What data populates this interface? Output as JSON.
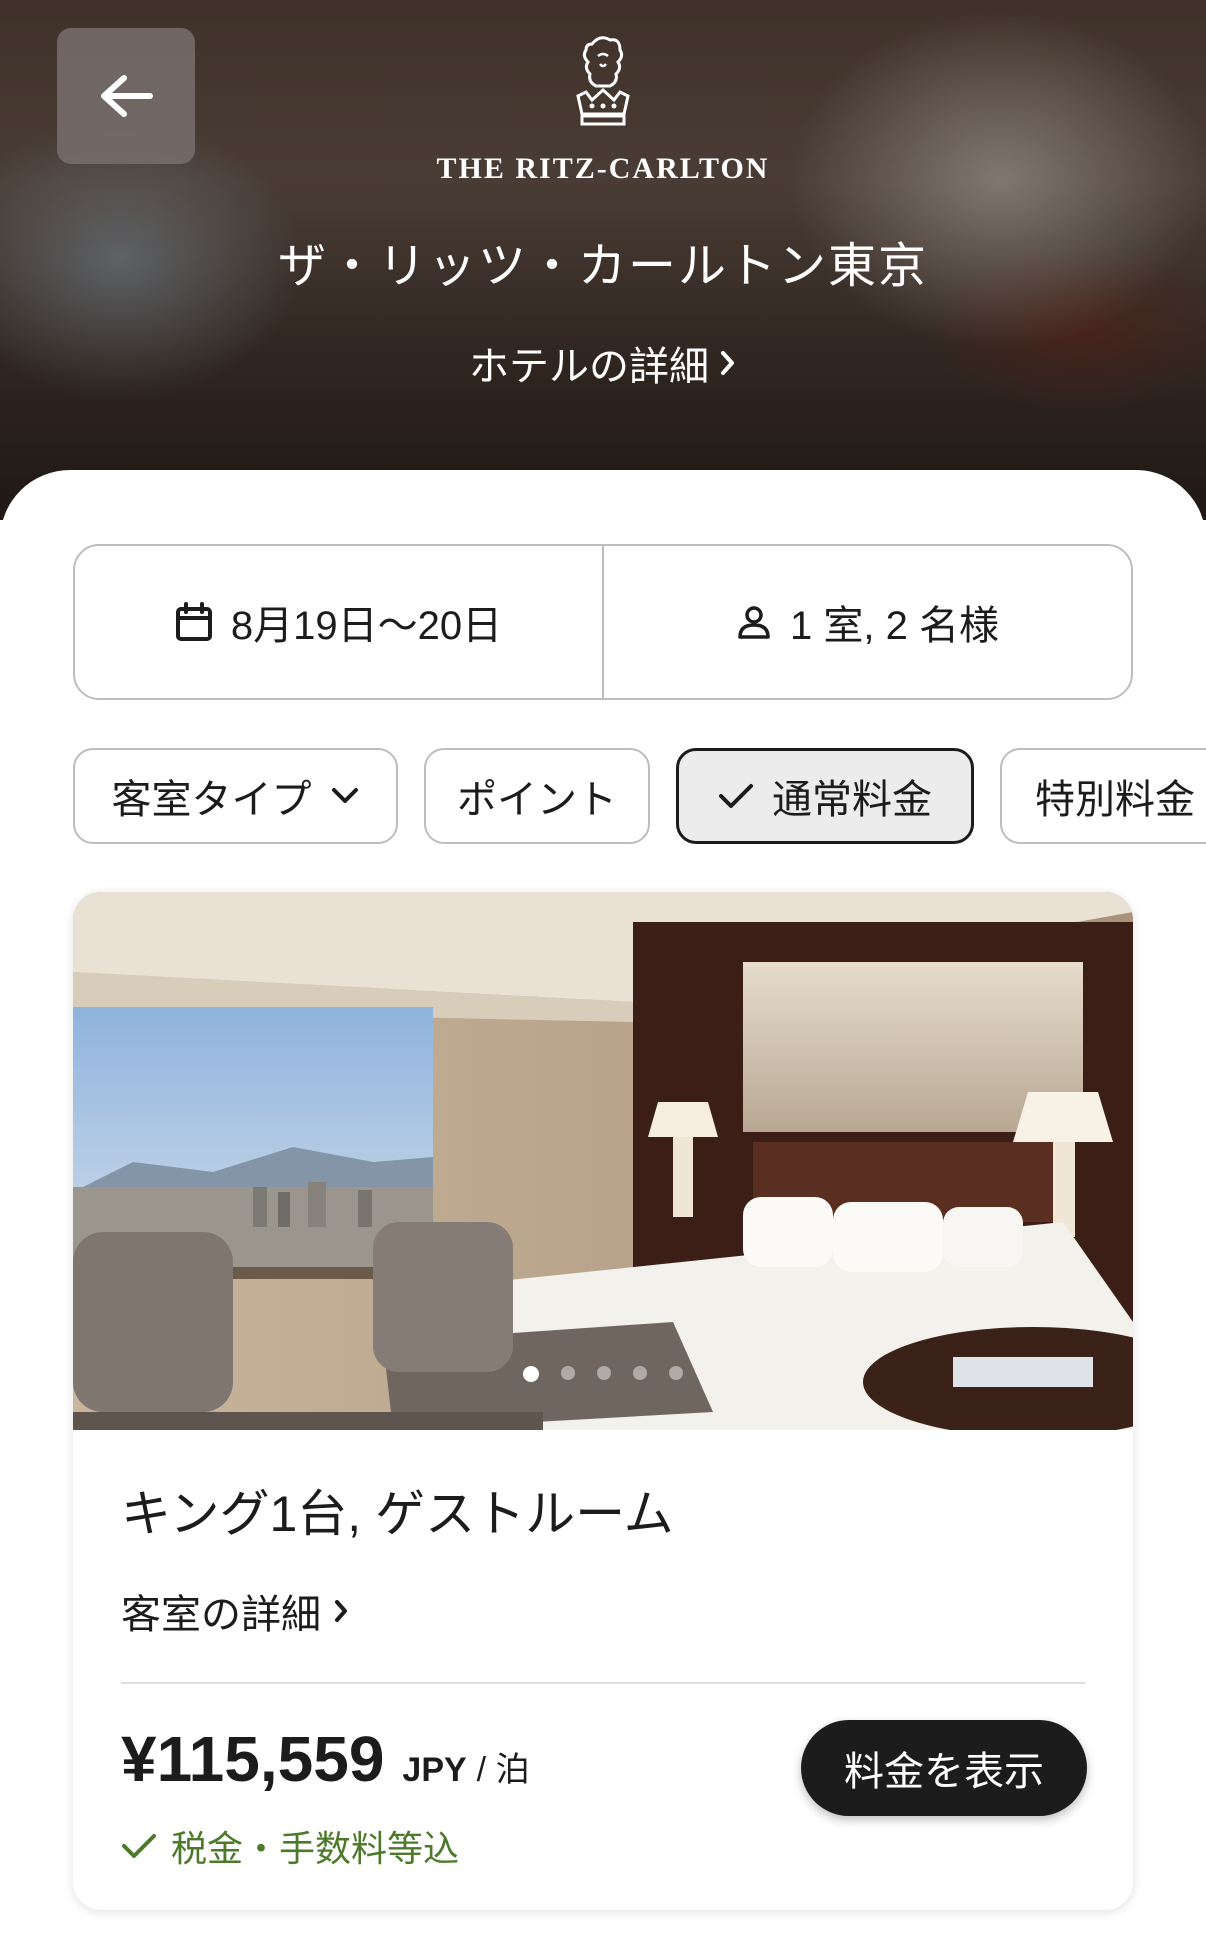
{
  "header": {
    "back_icon": "arrow-left-icon",
    "brand": "THE RITZ-CARLTON",
    "hotel_name": "ザ・リッツ・カールトン東京",
    "hotel_detail_link": "ホテルの詳細"
  },
  "search": {
    "dates": "8月19日～20日",
    "guests": "1 室, 2 名様"
  },
  "filters": [
    {
      "label": "客室タイプ",
      "selected": false,
      "has_dropdown": true
    },
    {
      "label": "ポイント",
      "selected": false
    },
    {
      "label": "通常料金",
      "selected": true
    },
    {
      "label": "特別料金",
      "selected": false
    }
  ],
  "room": {
    "title": "キング1台, ゲストルーム",
    "detail_link": "客室の詳細",
    "price": "¥115,559",
    "currency": "JPY",
    "per_night": "/ 泊",
    "tax_note": "税金・手数料等込",
    "cta": "料金を表示",
    "photo_count": 5,
    "photo_index": 1
  },
  "colors": {
    "accent_green": "#4d7a2a",
    "button_dark": "#1c1c1c"
  }
}
